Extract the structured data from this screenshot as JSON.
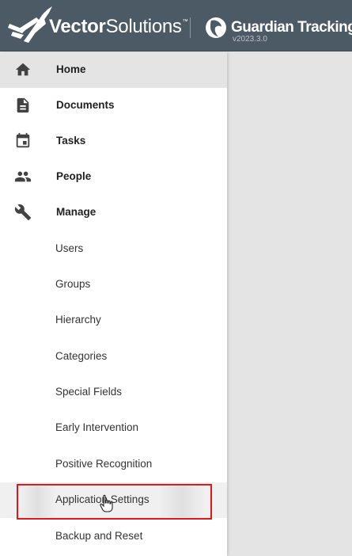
{
  "header": {
    "brand_bold": "Vector",
    "brand_regular": "Solutions",
    "brand_tm": "™",
    "product_title": "Guardian Tracking",
    "product_version": "v2023.3.0"
  },
  "sidebar": {
    "main_items": [
      {
        "label": "Home",
        "icon": "home-icon",
        "active": true
      },
      {
        "label": "Documents",
        "icon": "document-icon"
      },
      {
        "label": "Tasks",
        "icon": "calendar-icon"
      },
      {
        "label": "People",
        "icon": "people-icon"
      },
      {
        "label": "Manage",
        "icon": "wrench-icon"
      }
    ],
    "manage_items": [
      {
        "label": "Users"
      },
      {
        "label": "Groups"
      },
      {
        "label": "Hierarchy"
      },
      {
        "label": "Categories"
      },
      {
        "label": "Special Fields"
      },
      {
        "label": "Early Intervention"
      },
      {
        "label": "Positive Recognition"
      },
      {
        "label": "Application Settings",
        "highlighted": true
      },
      {
        "label": "Backup and Reset"
      }
    ]
  },
  "colors": {
    "header_bg": "#4c5a66",
    "active_bg": "#e4e4e4",
    "highlight_border": "#e01818"
  }
}
